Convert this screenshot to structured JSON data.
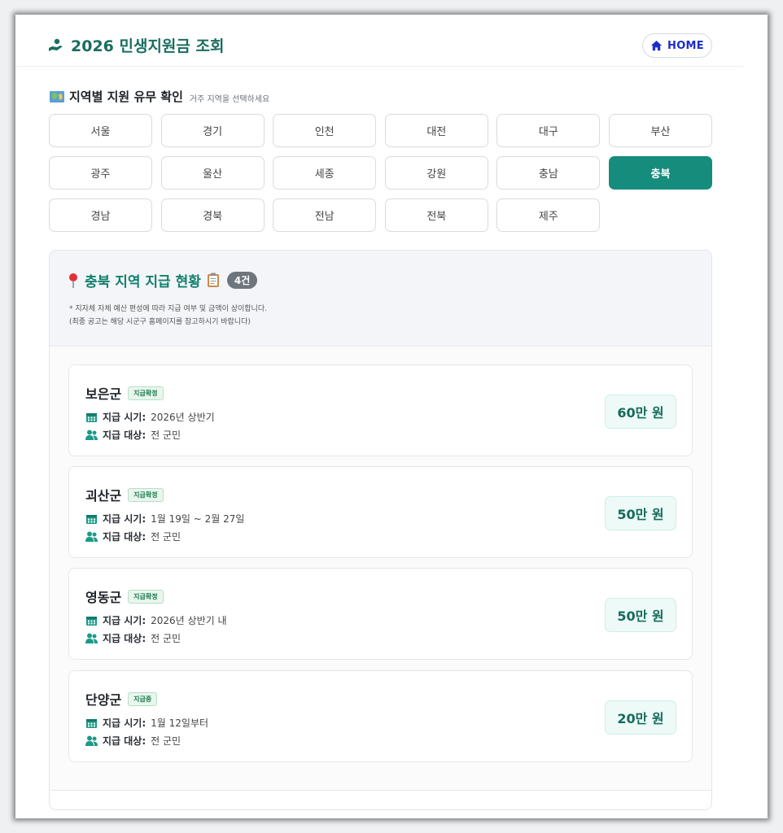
{
  "header": {
    "title": "2026 민생지원금 조회",
    "home_label": "HOME"
  },
  "regions_section": {
    "title": "지역별 지원 유무 확인",
    "subtitle": "거주 지역을 선택하세요",
    "regions": [
      "서울",
      "경기",
      "인천",
      "대전",
      "대구",
      "부산",
      "광주",
      "울산",
      "세종",
      "강원",
      "충남",
      "충북",
      "경남",
      "경북",
      "전남",
      "전북",
      "제주"
    ],
    "selected": "충북"
  },
  "results": {
    "title": "충북 지역 지급 현황",
    "count": "4건",
    "note1": "* 지자체 자체 예산 편성에 따라 지급 여부 및 금액이 상이합니다.",
    "note2": "(최종 공고는 해당 시군구 홈페이지를 참고하시기 바랍니다)",
    "time_label": "지급 시기:",
    "target_label": "지급 대상:",
    "items": [
      {
        "name": "보은군",
        "status": "지급확정",
        "time": "2026년 상반기",
        "target": "전 군민",
        "amount": "60만 원"
      },
      {
        "name": "괴산군",
        "status": "지급확정",
        "time": "1월 19일 ~ 2월 27일",
        "target": "전 군민",
        "amount": "50만 원"
      },
      {
        "name": "영동군",
        "status": "지급확정",
        "time": "2026년 상반기 내",
        "target": "전 군민",
        "amount": "50만 원"
      },
      {
        "name": "단양군",
        "status": "지급중",
        "time": "1월 12일부터",
        "target": "전 군민",
        "amount": "20만 원"
      }
    ]
  },
  "colors": {
    "accent": "#168c7d",
    "title_green": "#1a6e5f",
    "home_blue": "#1d2cc9"
  },
  "icons": {
    "title_icon": "hand-holding-icon",
    "home_icon": "home-icon",
    "map_icon": "map-icon",
    "pin_icon": "pin-icon",
    "clipboard_icon": "clipboard-icon",
    "calendar_icon": "calendar-icon",
    "users_icon": "users-icon"
  }
}
